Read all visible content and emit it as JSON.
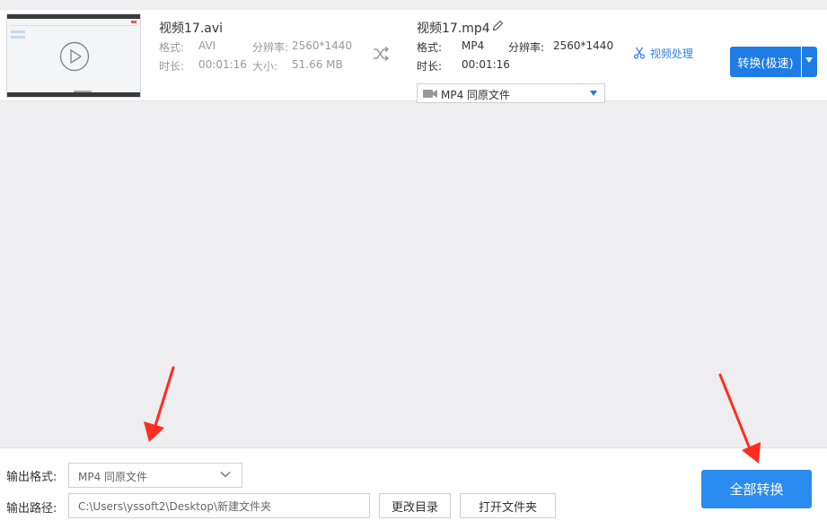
{
  "source": {
    "filename": "视频17.avi",
    "format_label": "格式:",
    "format_value": "AVI",
    "resolution_label": "分辨率:",
    "resolution_value": "2560*1440",
    "duration_label": "时长:",
    "duration_value": "00:01:16",
    "size_label": "大小:",
    "size_value": "51.66 MB"
  },
  "output_file": {
    "filename": "视频17.mp4",
    "format_label": "格式:",
    "format_value": "MP4",
    "resolution_label": "分辨率:",
    "resolution_value": "2560*1440",
    "duration_label": "时长:",
    "duration_value": "00:01:16",
    "format_select_value": "MP4  同原文件"
  },
  "actions": {
    "video_process_label": "视频处理",
    "convert_label": "转换(极速)"
  },
  "bottom": {
    "output_format_label": "输出格式:",
    "output_format_value": "MP4  同原文件",
    "output_path_label": "输出路径:",
    "output_path_value": "C:\\Users\\yssoft2\\Desktop\\新建文件夹",
    "change_dir_label": "更改目录",
    "open_folder_label": "打开文件夹",
    "convert_all_label": "全部转换"
  },
  "colors": {
    "accent": "#1e7ce4",
    "convert_all": "#2a8cf0",
    "annotation_arrow": "#ff2d1f"
  },
  "icons": {
    "thumbnail_play": "play-circle-icon",
    "swap": "shuffle-icon",
    "rename": "pencil-icon",
    "format_select": "video-camera-icon",
    "video_process": "scissors-icon"
  }
}
